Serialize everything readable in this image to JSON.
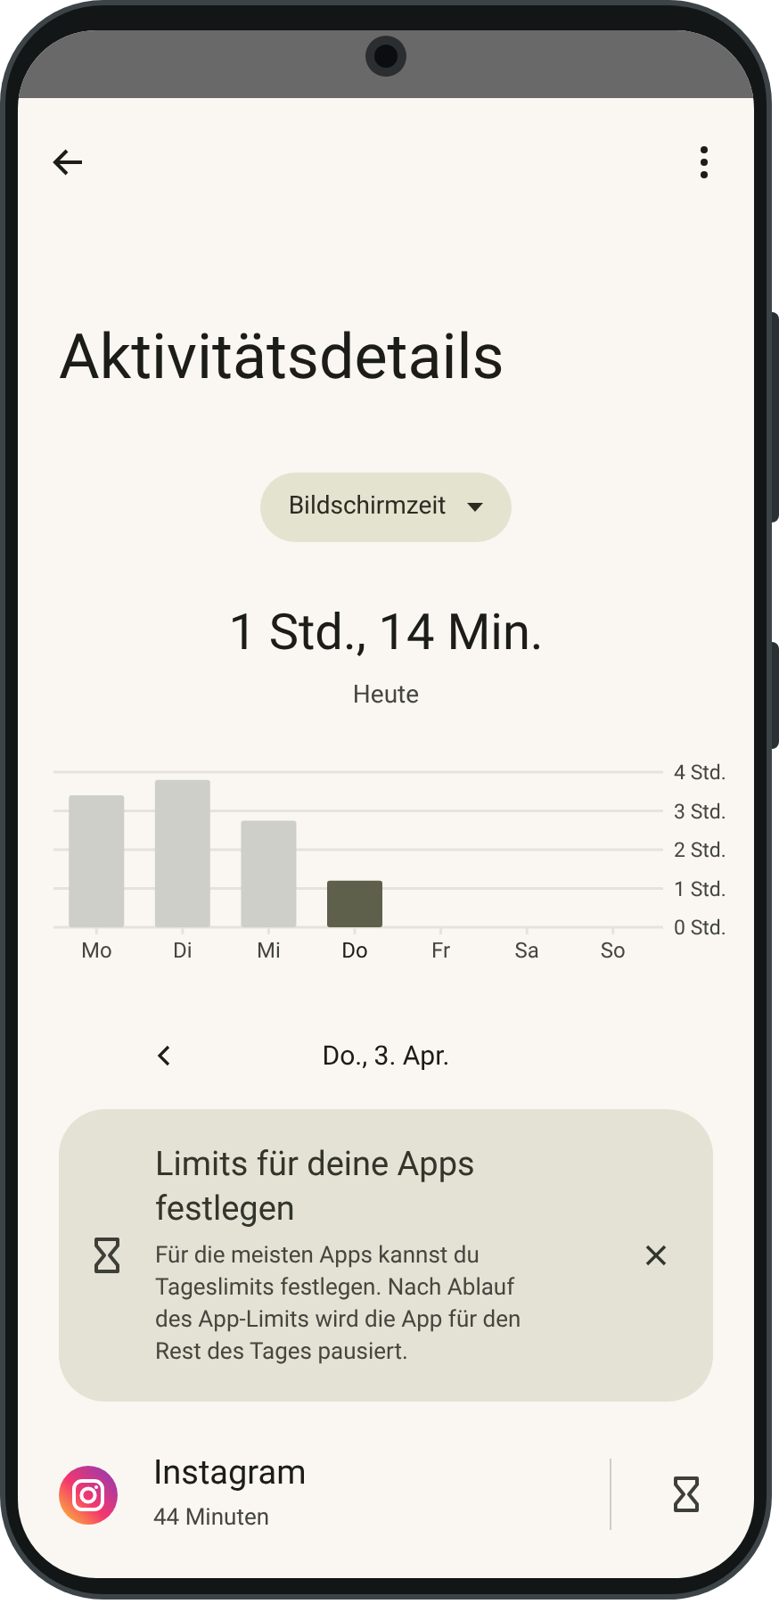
{
  "title": "Aktivitätsdetails",
  "metric_dropdown": {
    "label": "Bildschirmzeit"
  },
  "total": "1 Std., 14 Min.",
  "period": "Heute",
  "usage_chart": {
    "selected": [
      false,
      false,
      false,
      true,
      false,
      false,
      false
    ],
    "chart_data": {
      "type": "bar",
      "grid": true,
      "categories": [
        "Mo",
        "Di",
        "Mi",
        "Do",
        "Fr",
        "Sa",
        "So"
      ],
      "values": [
        3.4,
        3.8,
        2.75,
        1.2,
        null,
        null,
        null
      ],
      "ylim": [
        0,
        4
      ],
      "yticks": [
        {
          "value": 0,
          "label": "0 Std."
        },
        {
          "value": 1,
          "label": "1 Std."
        },
        {
          "value": 2,
          "label": "2 Std."
        },
        {
          "value": 3,
          "label": "3 Std."
        },
        {
          "value": 4,
          "label": "4 Std."
        }
      ]
    }
  },
  "date_nav": {
    "date": "Do., 3. Apr."
  },
  "tip_card": {
    "title": "Limits für deine Apps festlegen",
    "body": "Für die meisten Apps kannst du Tageslimits festlegen. Nach Ablauf des App-Limits wird die App für den Rest des Tages pausiert."
  },
  "apps": [
    {
      "name": "Instagram",
      "usage": "44 Minuten"
    }
  ]
}
